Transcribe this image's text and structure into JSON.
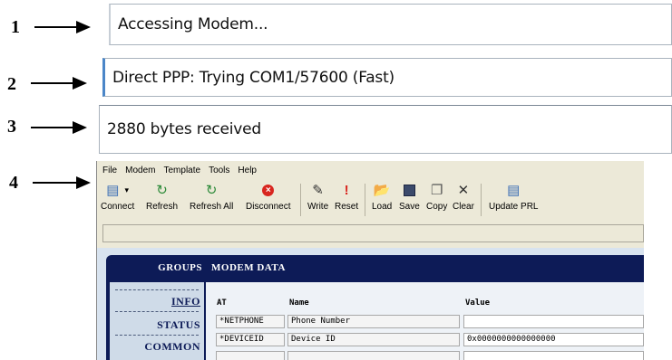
{
  "steps": [
    "1",
    "2",
    "3",
    "4"
  ],
  "status": {
    "line1": "Accessing Modem...",
    "line2": "Direct PPP: Trying COM1/57600 (Fast)",
    "line3": "2880 bytes received"
  },
  "app": {
    "menu": [
      "File",
      "Modem",
      "Template",
      "Tools",
      "Help"
    ],
    "toolbar": {
      "connect": "Connect",
      "refresh": "Refresh",
      "refresh_all": "Refresh All",
      "disconnect": "Disconnect",
      "write": "Write",
      "reset": "Reset",
      "load": "Load",
      "save": "Save",
      "copy": "Copy",
      "clear": "Clear",
      "update_prl": "Update PRL"
    },
    "groups_header": "GROUPS",
    "modem_header": "MODEM DATA",
    "groups": [
      "INFO",
      "STATUS",
      "COMMON"
    ],
    "columns": {
      "at": "AT",
      "name": "Name",
      "value": "Value"
    },
    "rows": [
      {
        "at": "*NETPHONE",
        "name": "Phone Number",
        "value": ""
      },
      {
        "at": "*DEVICEID",
        "name": "Device ID",
        "value": "0x0000000000000000"
      }
    ]
  }
}
